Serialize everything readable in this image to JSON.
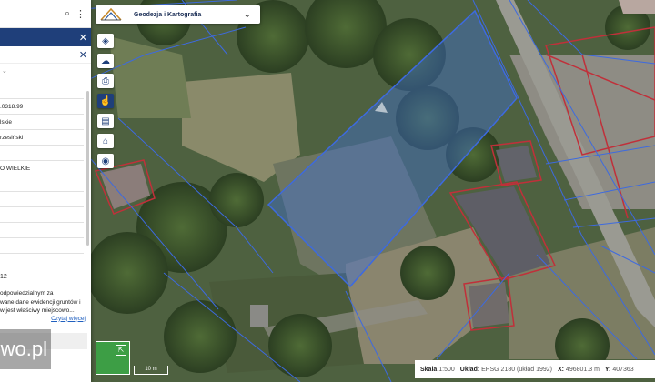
{
  "panel": {
    "close_top": "✕",
    "close_sub": "✕",
    "chevron": "⌄",
    "rows": [
      "",
      ".0318.99",
      "lskie",
      "rzesiński",
      "",
      "O WIELKIE",
      "",
      "",
      "",
      "",
      ""
    ],
    "number": "12",
    "note_lines": [
      "odpowiedzialnym za",
      "wane dane ewidencji gruntów i",
      "w jest właściwy miejscowo..."
    ],
    "more_link": "Czytaj więcej"
  },
  "watermark": "wo.pl",
  "header": {
    "title": "Geodezja i Kartografia",
    "chevron": "⌄"
  },
  "toolbar": [
    {
      "name": "layers-icon",
      "glyph": "◈"
    },
    {
      "name": "cloud-icon",
      "glyph": "☁"
    },
    {
      "name": "print-icon",
      "glyph": "⎙"
    },
    {
      "name": "hand-pointer-icon",
      "glyph": "☝"
    },
    {
      "name": "document-icon",
      "glyph": "▤"
    },
    {
      "name": "home-search-icon",
      "glyph": "⌂"
    },
    {
      "name": "camera-icon",
      "glyph": "◉"
    }
  ],
  "minimap_icon": "⇱",
  "scalebar": "10 m",
  "status": {
    "scale_label": "Skala",
    "scale_value": "1:500",
    "crs_label": "Układ:",
    "crs_value": "EPSG 2180 (układ 1992)",
    "x_label": "X:",
    "x_value": "496801.3 m",
    "y_label": "Y:",
    "y_value": "407363"
  },
  "colors": {
    "panel_header": "#1f3f7a",
    "parcel_fill": "#3d6fd8",
    "parcel_line": "#3d6ae0",
    "building_line": "#c0303a"
  }
}
